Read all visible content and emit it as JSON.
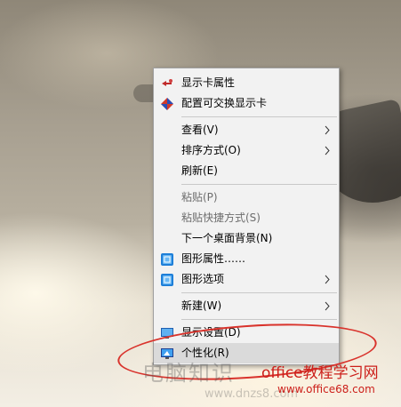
{
  "context_menu": {
    "items": [
      {
        "label": "显示卡属性",
        "icon": "graphics-properties-icon",
        "disabled": false,
        "submenu": false
      },
      {
        "label": "配置可交换显示卡",
        "icon": "switchable-graphics-icon",
        "disabled": false,
        "submenu": false
      },
      {
        "label": "查看(V)",
        "disabled": false,
        "submenu": true
      },
      {
        "label": "排序方式(O)",
        "disabled": false,
        "submenu": true
      },
      {
        "label": "刷新(E)",
        "disabled": false,
        "submenu": false
      },
      {
        "label": "粘贴(P)",
        "disabled": true,
        "submenu": false
      },
      {
        "label": "粘贴快捷方式(S)",
        "disabled": true,
        "submenu": false
      },
      {
        "label": "下一个桌面背景(N)",
        "disabled": false,
        "submenu": false
      },
      {
        "label": "图形属性……",
        "icon": "intel-graphics-icon",
        "disabled": false,
        "submenu": false
      },
      {
        "label": "图形选项",
        "icon": "intel-graphics-icon",
        "disabled": false,
        "submenu": true
      },
      {
        "label": "新建(W)",
        "disabled": false,
        "submenu": true
      },
      {
        "label": "显示设置(D)",
        "icon": "display-settings-icon",
        "disabled": false,
        "submenu": false
      },
      {
        "label": "个性化(R)",
        "icon": "personalize-icon",
        "disabled": false,
        "submenu": false,
        "highlighted": true
      }
    ]
  },
  "watermark": {
    "main": "office教程学习网",
    "url": "www.office68.com",
    "faded": "电脑知识",
    "faded_url": "www.dnzs8.com"
  },
  "colors": {
    "menu_bg": "#f2f2f2",
    "highlight_bg": "#dadada",
    "annotation_red": "#d9332c"
  }
}
